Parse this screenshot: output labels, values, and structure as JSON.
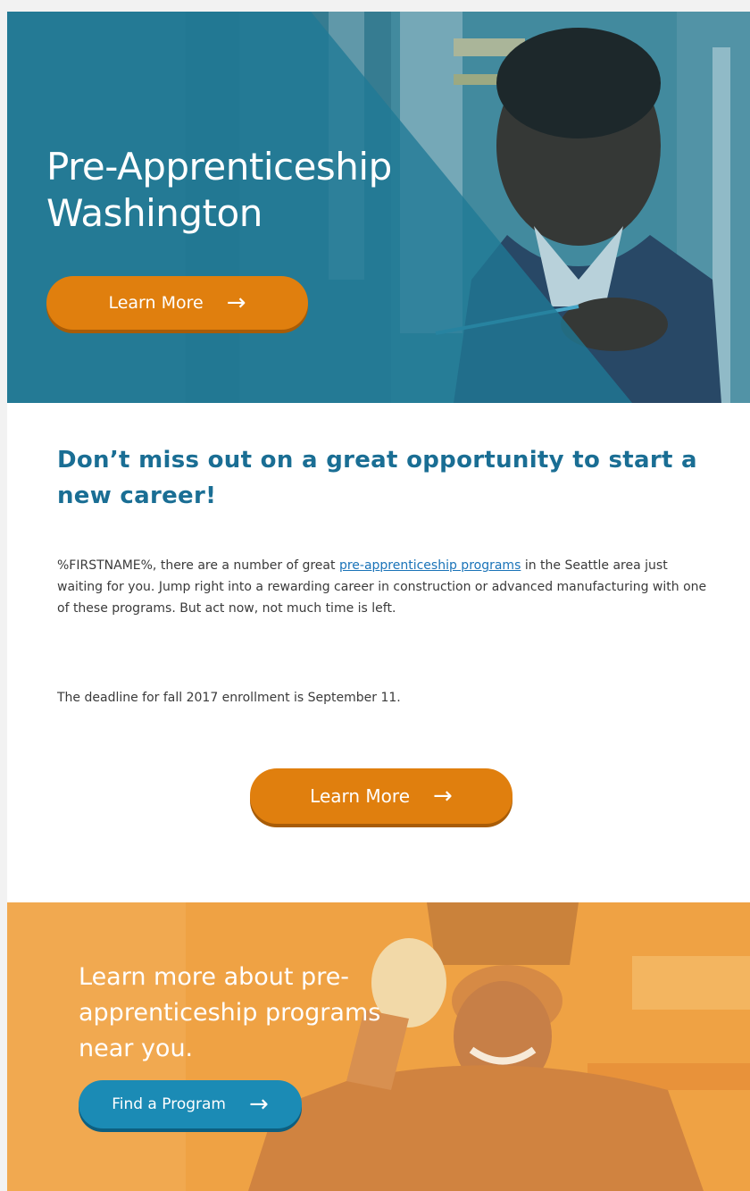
{
  "hero": {
    "title": "Pre-Apprenticeship Washington",
    "button_label": "Learn More",
    "button_icon": "arrow-right-icon",
    "overlay_color": "#1f7a96"
  },
  "main": {
    "headline": "Don’t miss out on a great opportunity to start a new career!",
    "intro_prefix": "%FIRSTNAME%, there are a number of great ",
    "intro_link": "pre-apprenticeship programs",
    "intro_suffix": " in the Seattle area just waiting for you. Jump right into a rewarding career in construction or advanced manufacturing with one of these programs. But act now, not much time is left.",
    "deadline": "The deadline for fall 2017 enrollment is September 11.",
    "button_label": "Learn More",
    "button_icon": "arrow-right-icon"
  },
  "banner": {
    "text": "Learn more about pre-apprenticeship programs near you.",
    "button_label": "Find a Program",
    "button_icon": "arrow-right-icon",
    "overlay_color": "#f0a240"
  },
  "colors": {
    "accent_orange": "#e07f0e",
    "accent_blue": "#1b8bb5",
    "headline_blue": "#1a6e94",
    "link_blue": "#1a73b8"
  }
}
